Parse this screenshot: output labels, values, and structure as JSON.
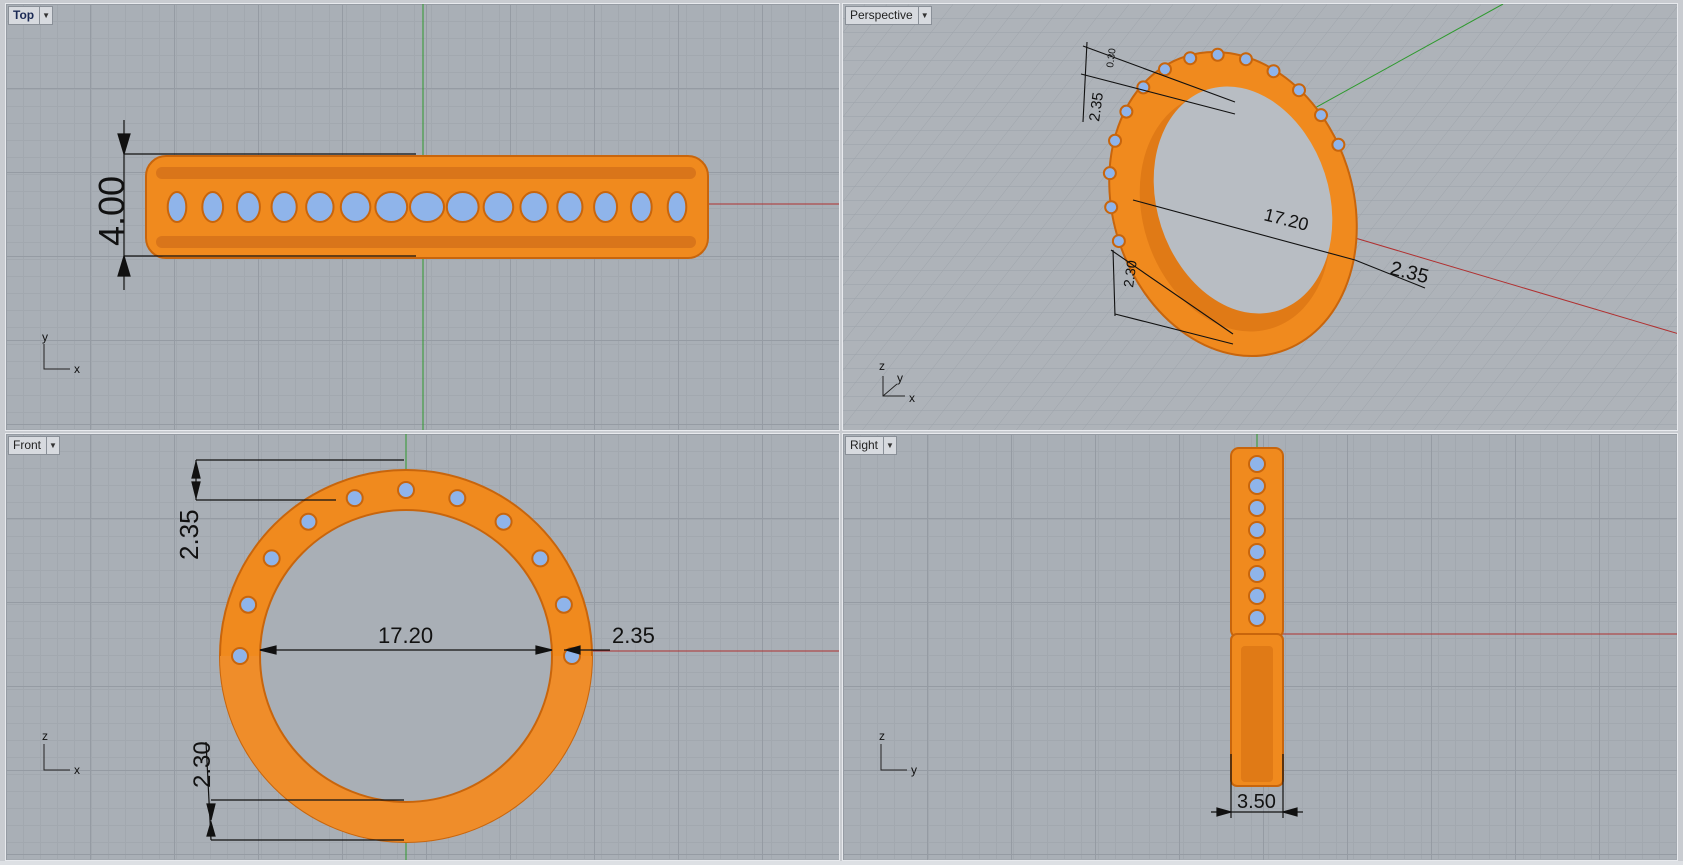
{
  "viewports": {
    "top": {
      "label": "Top",
      "axes": {
        "a": "y",
        "b": "x"
      },
      "dims": {
        "width": "4.00"
      }
    },
    "perspective": {
      "label": "Perspective",
      "axes": {
        "a": "z",
        "b": "y",
        "c": "x"
      },
      "dims": {
        "top_width": "2.35",
        "small": "0.30",
        "diameter": "17.20",
        "side": "2.35",
        "bottom": "2.30"
      }
    },
    "front": {
      "label": "Front",
      "axes": {
        "a": "z",
        "b": "x"
      },
      "dims": {
        "top": "2.35",
        "diameter": "17.20",
        "side": "2.35",
        "bottom": "2.30"
      }
    },
    "right": {
      "label": "Right",
      "axes": {
        "a": "z",
        "b": "y"
      },
      "dims": {
        "width": "3.50"
      }
    }
  },
  "colors": {
    "metal": "#f08a1e",
    "metal_dark": "#c8650c",
    "gem": "#8fb4ea",
    "x_axis": "#b03030",
    "y_axis": "#2e9a2e"
  }
}
